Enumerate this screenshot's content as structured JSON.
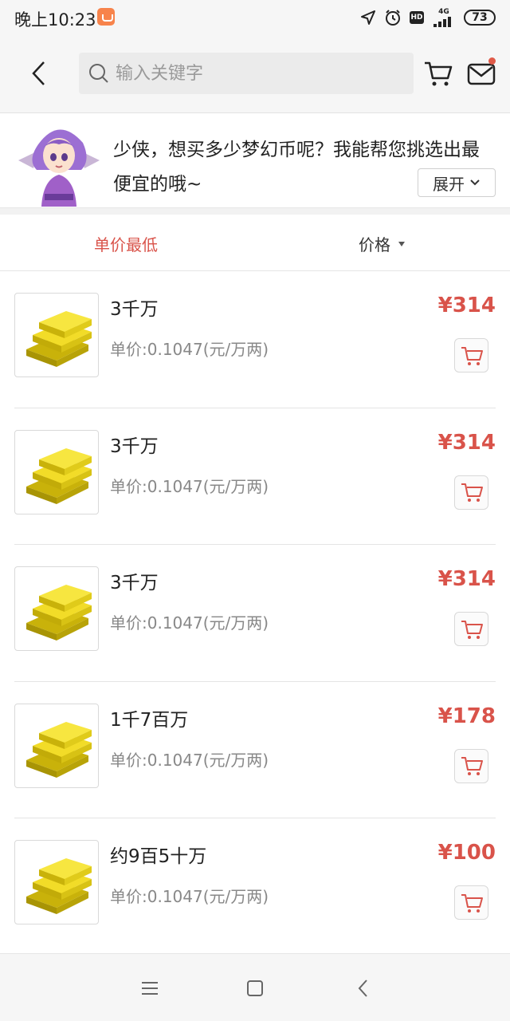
{
  "status_bar": {
    "time": "晚上10:23",
    "network": "4G",
    "hd": "HD",
    "battery": "73"
  },
  "header": {
    "search_placeholder": "输入关键字"
  },
  "banner": {
    "message": "少侠，想买多少梦幻币呢？我能帮您挑选出最便宜的哦~",
    "expand_label": "展开"
  },
  "sort": {
    "unit_price_label": "单价最低",
    "price_label": "价格"
  },
  "items": [
    {
      "title": "3千万",
      "unit_price": "单价:0.1047(元/万两)",
      "price": "¥314"
    },
    {
      "title": "3千万",
      "unit_price": "单价:0.1047(元/万两)",
      "price": "¥314"
    },
    {
      "title": "3千万",
      "unit_price": "单价:0.1047(元/万两)",
      "price": "¥314"
    },
    {
      "title": "1千7百万",
      "unit_price": "单价:0.1047(元/万两)",
      "price": "¥178"
    },
    {
      "title": "约9百5十万",
      "unit_price": "单价:0.1047(元/万两)",
      "price": "¥100"
    }
  ],
  "colors": {
    "accent": "#d9534a",
    "gold": "#e8d21c"
  }
}
